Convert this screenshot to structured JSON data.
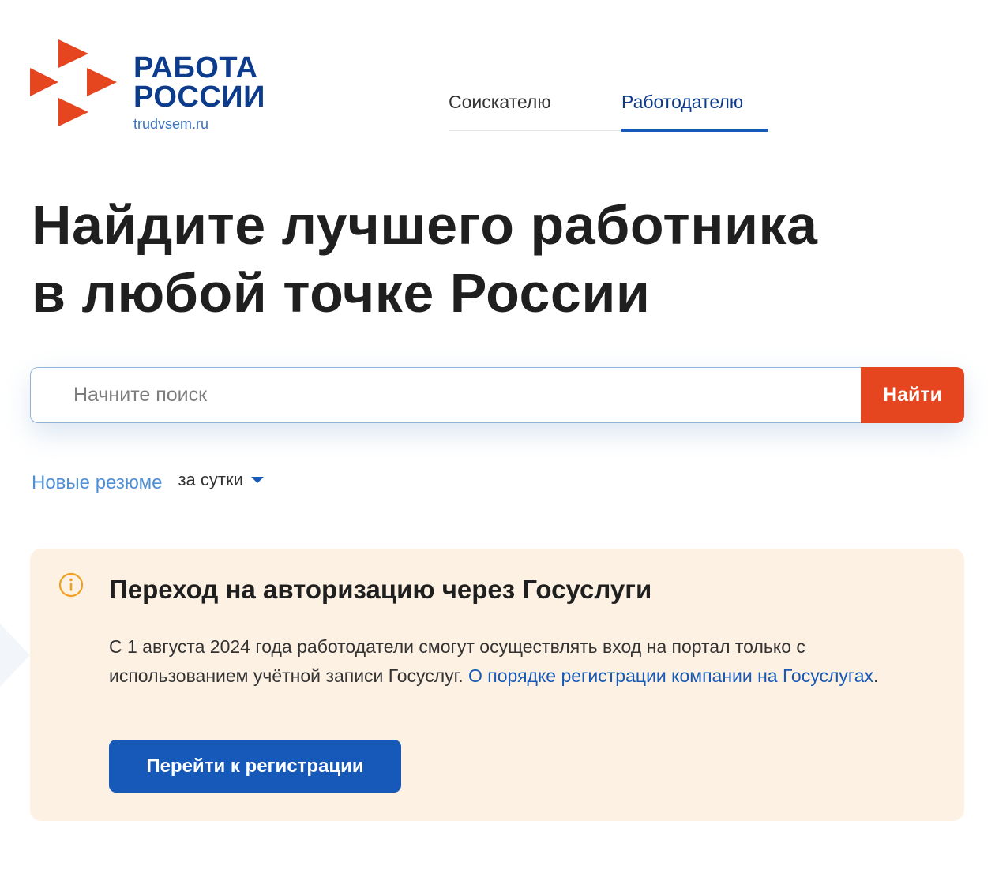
{
  "header": {
    "logo": {
      "line1": "РАБОТА",
      "line2": "РОССИИ",
      "domain": "trudvsem.ru",
      "icon": "logo-arrows-mark",
      "color": "#e6461f"
    },
    "tabs": [
      {
        "label": "Соискателю",
        "active": false
      },
      {
        "label": "Работодателю",
        "active": true
      }
    ]
  },
  "hero": {
    "line1": "Найдите лучшего работника",
    "line2": "в любой точке России"
  },
  "search": {
    "placeholder": "Начните поиск",
    "value": "",
    "button_label": "Найти",
    "button_color": "#e6461f"
  },
  "resumes": {
    "link_label": "Новые резюме",
    "period_selected": "за сутки",
    "period_icon": "caret-down-icon"
  },
  "notice": {
    "icon": "info-icon",
    "title": "Переход на авторизацию через Госуслуги",
    "body_text": "С 1 августа 2024 года работодатели смогут осуществлять вход на портал только с использованием учётной записи Госуслуг. ",
    "body_link": "О порядке регистрации компании на Госуслугах",
    "body_end": ".",
    "button_label": "Перейти к регистрации",
    "background": "#fdf1e3",
    "button_color": "#1659b8"
  }
}
